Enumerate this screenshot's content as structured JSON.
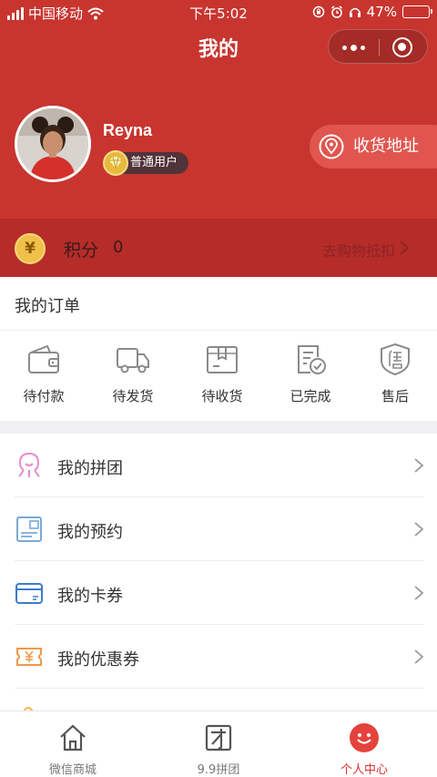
{
  "status_bar": {
    "carrier": "中国移动",
    "time": "下午5:02",
    "battery": "47%",
    "battery_level": 0.47,
    "icons": [
      "signal-icon",
      "wifi-icon",
      "lock-rotation-icon",
      "alarm-icon",
      "headphones-icon",
      "battery-icon"
    ]
  },
  "nav": {
    "title": "我的"
  },
  "profile": {
    "username": "Reyna",
    "badge": "普通用户",
    "address_button": "收货地址"
  },
  "points": {
    "coin_symbol": "¥",
    "label": "积分",
    "value": "0",
    "link": "去购物抵扣"
  },
  "orders": {
    "title": "我的订单",
    "items": [
      {
        "label": "待付款",
        "icon": "wallet-icon"
      },
      {
        "label": "待发货",
        "icon": "truck-icon"
      },
      {
        "label": "待收货",
        "icon": "package-icon"
      },
      {
        "label": "已完成",
        "icon": "completed-doc-icon"
      },
      {
        "label": "售后",
        "icon": "after-sales-shield-icon"
      }
    ]
  },
  "menu": [
    {
      "label": "我的拼团",
      "icon": "group-buy-icon"
    },
    {
      "label": "我的预约",
      "icon": "reservation-icon"
    },
    {
      "label": "我的卡券",
      "icon": "card-icon"
    },
    {
      "label": "我的优惠券",
      "icon": "coupon-icon"
    }
  ],
  "tabbar": [
    {
      "label": "微信商城",
      "icon": "home-icon",
      "active": false
    },
    {
      "label": "9.9拼团",
      "icon": "group-tab-icon",
      "active": false
    },
    {
      "label": "个人中心",
      "icon": "smile-face-icon",
      "active": true
    }
  ],
  "colors": {
    "header_red": "#c8352f",
    "points_bar": "#b52c29",
    "address_button": "#e0564f",
    "active_tab": "#d7332d",
    "coin_gold": "#f0c04a"
  }
}
